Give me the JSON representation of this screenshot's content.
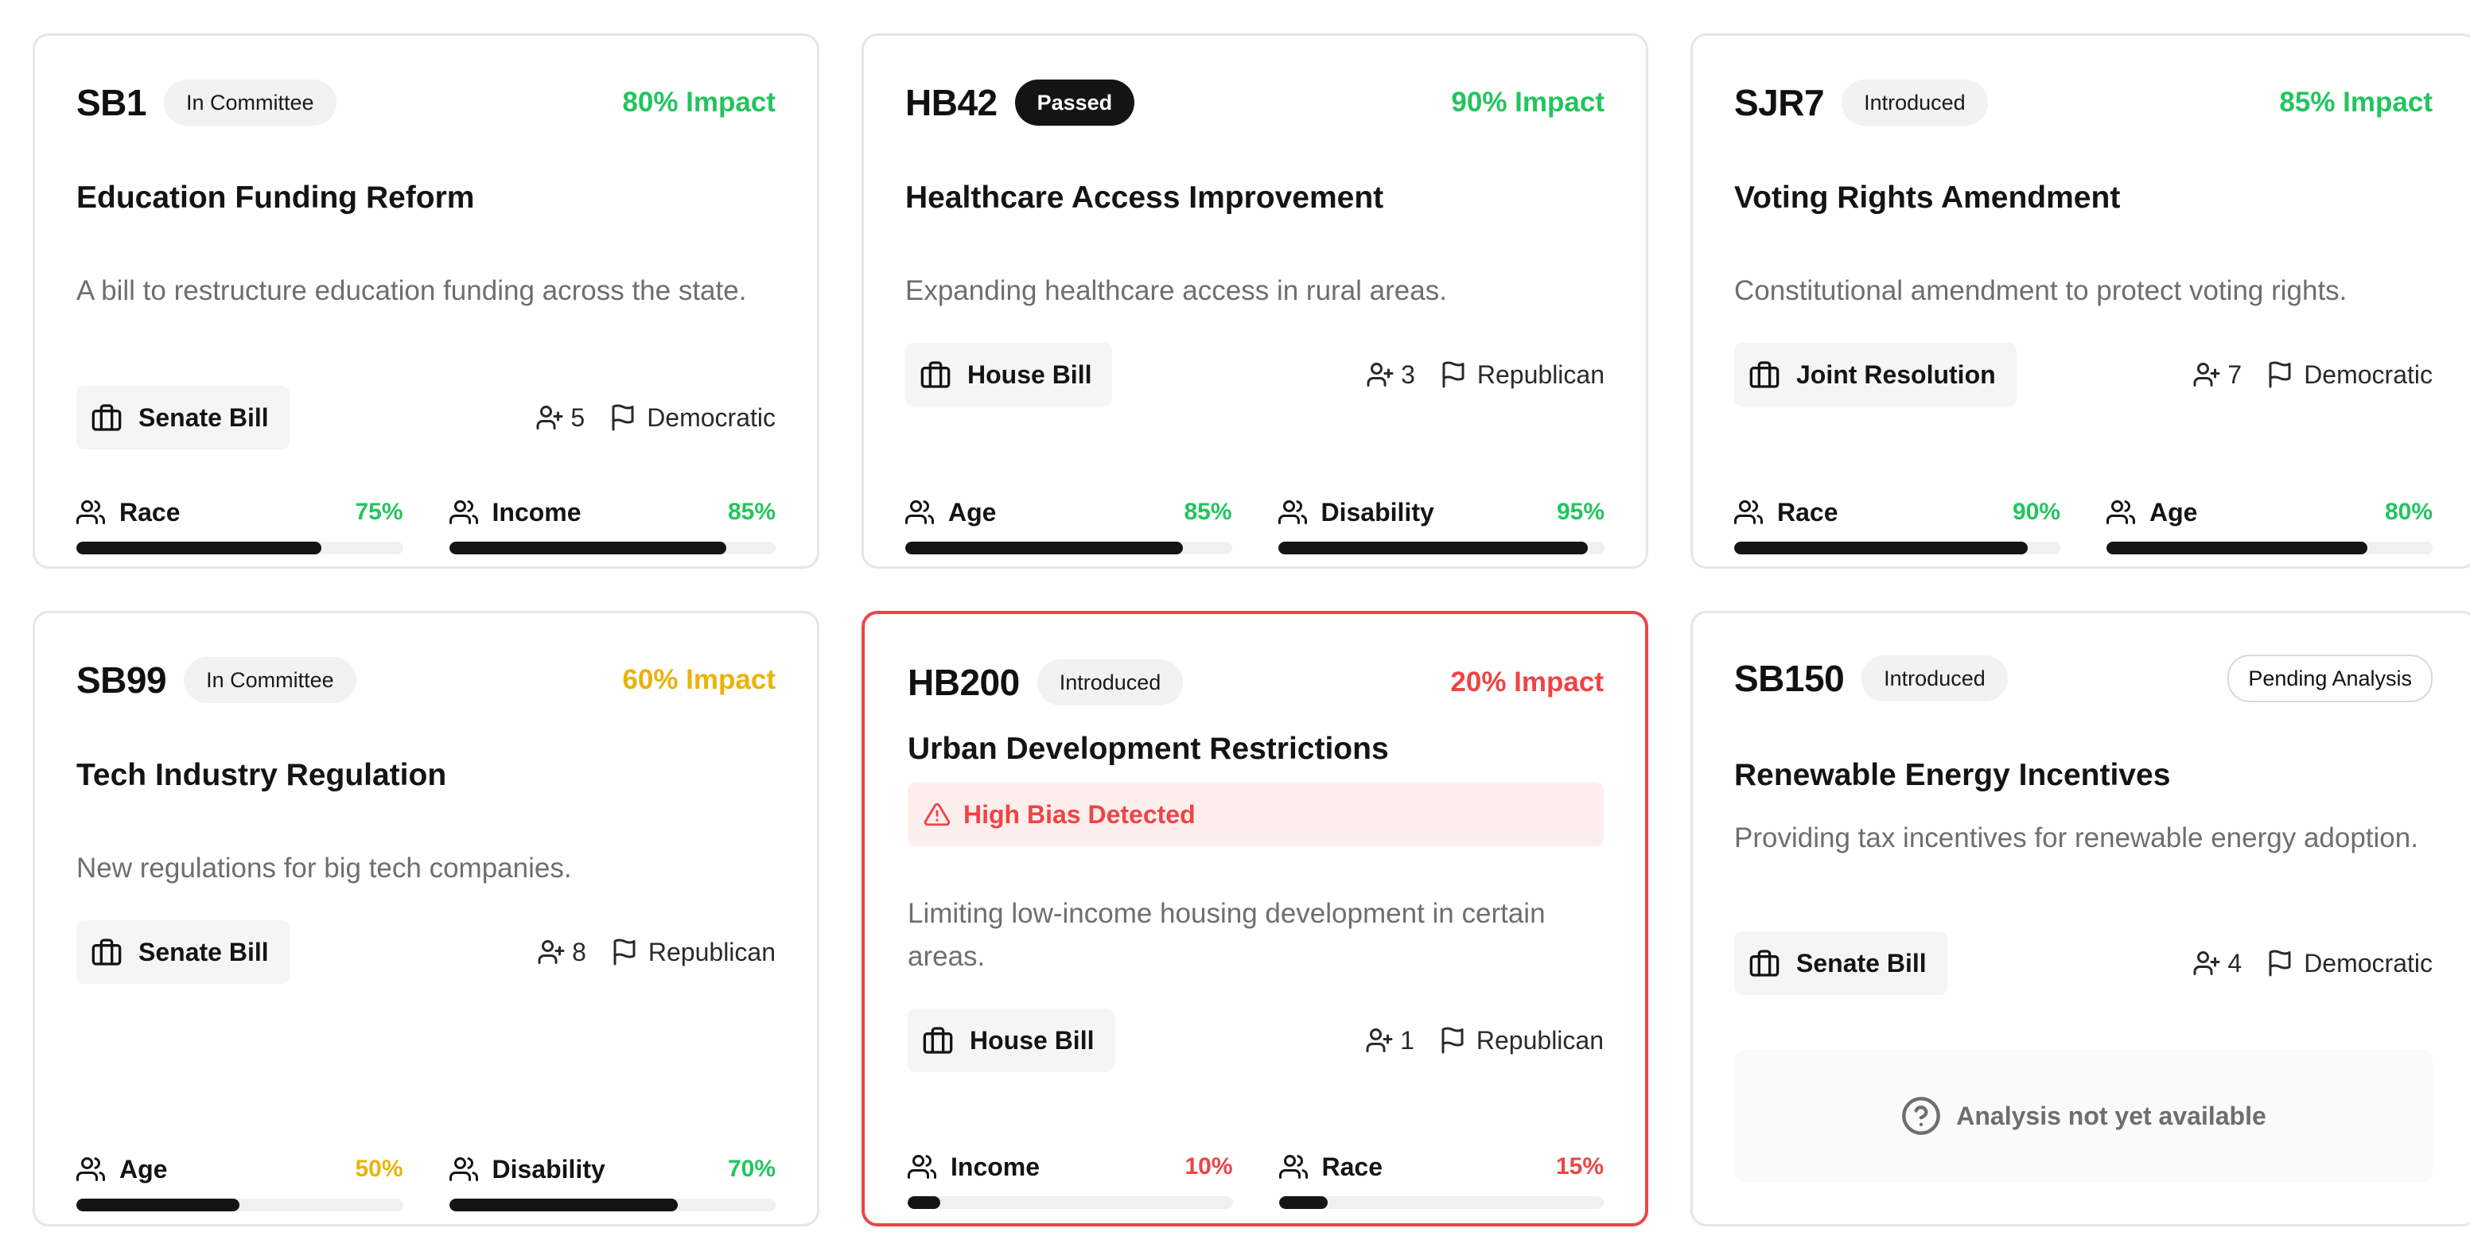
{
  "colors": {
    "green": "#22c55e",
    "amber": "#eab308",
    "red": "#ef4444",
    "bar": "#141414"
  },
  "icons": {
    "bill_type": "briefcase-icon",
    "sponsors": "user-plus-icon",
    "party": "flag-icon",
    "demographic": "users-icon",
    "alert": "alert-triangle-icon",
    "unavailable": "help-circle-icon"
  },
  "bills": [
    {
      "code": "SB1",
      "status": "In Committee",
      "impact": "80% Impact",
      "title": "Education Funding Reform",
      "description": "A bill to restructure education funding across the state.",
      "type": "Senate Bill",
      "sponsors": "5",
      "party": "Democratic",
      "metrics": [
        {
          "label": "Race",
          "pct": "75%",
          "value": 0.75
        },
        {
          "label": "Income",
          "pct": "85%",
          "value": 0.85
        }
      ]
    },
    {
      "code": "HB42",
      "status": "Passed",
      "impact": "90% Impact",
      "title": "Healthcare Access Improvement",
      "description": "Expanding healthcare access in rural areas.",
      "type": "House Bill",
      "sponsors": "3",
      "party": "Republican",
      "metrics": [
        {
          "label": "Age",
          "pct": "85%",
          "value": 0.85
        },
        {
          "label": "Disability",
          "pct": "95%",
          "value": 0.95
        }
      ]
    },
    {
      "code": "SJR7",
      "status": "Introduced",
      "impact": "85% Impact",
      "title": "Voting Rights Amendment",
      "description": "Constitutional amendment to protect voting rights.",
      "type": "Joint Resolution",
      "sponsors": "7",
      "party": "Democratic",
      "metrics": [
        {
          "label": "Race",
          "pct": "90%",
          "value": 0.9
        },
        {
          "label": "Age",
          "pct": "80%",
          "value": 0.8
        }
      ]
    },
    {
      "code": "SB99",
      "status": "In Committee",
      "impact": "60% Impact",
      "title": "Tech Industry Regulation",
      "description": "New regulations for big tech companies.",
      "type": "Senate Bill",
      "sponsors": "8",
      "party": "Republican",
      "metrics": [
        {
          "label": "Age",
          "pct": "50%",
          "value": 0.5
        },
        {
          "label": "Disability",
          "pct": "70%",
          "value": 0.7
        }
      ]
    },
    {
      "code": "HB200",
      "status": "Introduced",
      "impact": "20% Impact",
      "title": "Urban Development Restrictions",
      "alert": "High Bias Detected",
      "description": "Limiting low-income housing development in certain areas.",
      "type": "House Bill",
      "sponsors": "1",
      "party": "Republican",
      "metrics": [
        {
          "label": "Income",
          "pct": "10%",
          "value": 0.1
        },
        {
          "label": "Race",
          "pct": "15%",
          "value": 0.15
        }
      ]
    },
    {
      "code": "SB150",
      "status": "Introduced",
      "pending": "Pending Analysis",
      "title": "Renewable Energy Incentives",
      "description": "Providing tax incentives for renewable energy adoption.",
      "type": "Senate Bill",
      "sponsors": "4",
      "party": "Democratic",
      "unavailable": "Analysis not yet available"
    }
  ]
}
